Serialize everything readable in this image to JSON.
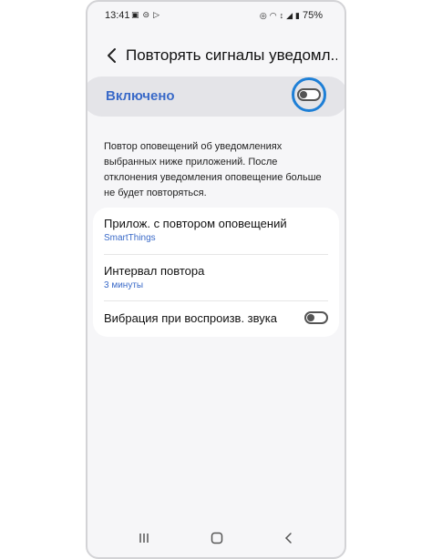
{
  "status_bar": {
    "time": "13:41",
    "battery": "75%"
  },
  "header": {
    "title": "Повторять сигналы уведомл..."
  },
  "master": {
    "label": "Включено",
    "enabled": false
  },
  "description": "Повтор оповещений об уведомлениях выбранных ниже приложений. После отклонения уведомления оповещение больше не будет повторяться.",
  "settings": [
    {
      "title": "Прилож. с повтором оповещений",
      "subtitle": "SmartThings"
    },
    {
      "title": "Интервал повтора",
      "subtitle": "3 минуты"
    },
    {
      "title": "Вибрация при воспроизв. звука",
      "enabled": false
    }
  ],
  "colors": {
    "accent": "#3a6ac8",
    "highlight": "#1e7fd6"
  }
}
